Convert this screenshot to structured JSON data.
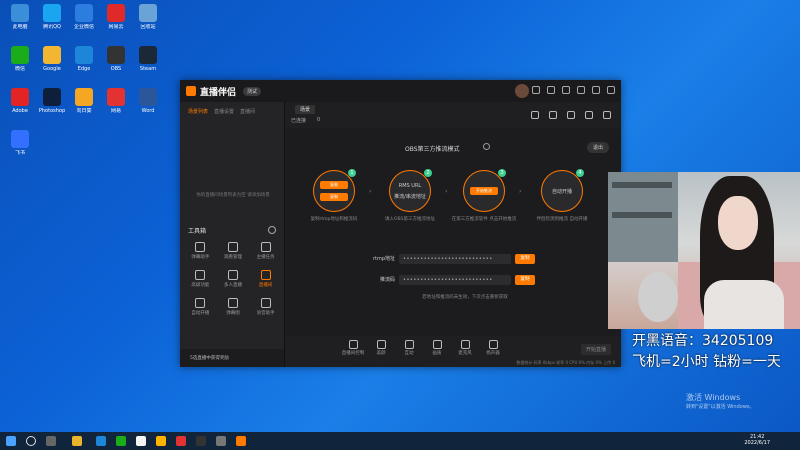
{
  "desktop": {
    "icons": [
      {
        "label": "此电脑",
        "color": "#3b8fd9"
      },
      {
        "label": "腾讯QQ",
        "color": "#1aa5f0"
      },
      {
        "label": "企业微信",
        "color": "#2c7de0"
      },
      {
        "label": "网易云",
        "color": "#e02a2a"
      },
      {
        "label": "回收站",
        "color": "#6aa4d6"
      },
      {
        "label": "微信",
        "color": "#1aad19"
      },
      {
        "label": "Google",
        "color": "#f2b632"
      },
      {
        "label": "Edge",
        "color": "#1d86d8"
      },
      {
        "label": "OBS",
        "color": "#333333"
      },
      {
        "label": "Steam",
        "color": "#1b2838"
      },
      {
        "label": "Adobe",
        "color": "#e22424"
      },
      {
        "label": "Photoshop",
        "color": "#0e1f3b"
      },
      {
        "label": "向日葵",
        "color": "#f5a623"
      },
      {
        "label": "网易",
        "color": "#e23232"
      },
      {
        "label": "Word",
        "color": "#2b579a"
      },
      {
        "label": "飞书",
        "color": "#3370ff"
      }
    ]
  },
  "app": {
    "title": "直播伴侣",
    "version": "测试",
    "left_tabs": [
      "场景列表",
      "直播设置",
      "直播间"
    ],
    "left_empty": "你的直播间场景列表为空 请添加场景",
    "toolbox_title": "工具箱",
    "tools": [
      {
        "label": "弹幕助手",
        "active": false
      },
      {
        "label": "观看管理",
        "active": false
      },
      {
        "label": "主播任务",
        "active": false
      },
      {
        "label": "高级功能",
        "active": false
      },
      {
        "label": "多人直播",
        "active": false
      },
      {
        "label": "直播间",
        "active": true
      },
      {
        "label": "自动开播",
        "active": false
      },
      {
        "label": "弹幕图",
        "active": false
      },
      {
        "label": "语音助手",
        "active": false
      }
    ],
    "left_bottom": "5选直播中获得奖励",
    "scene_tab": "场景",
    "live_status": "已连接",
    "fire_count": "0",
    "obs_title": "OBS第三方推流模式",
    "exit_label": "退出",
    "steps": [
      {
        "n": "1",
        "label": "复制",
        "sub": "复制",
        "desc": "复制rtmp地址和推流码",
        "inner": true
      },
      {
        "n": "2",
        "label": "RMS URL",
        "sub": "推流/串流地址",
        "desc": "填入OBS第三方推流地址",
        "inner": false
      },
      {
        "n": "3",
        "label": "开始推流",
        "sub": "",
        "desc": "在第三方推流软件 点击开始推流",
        "inner": true
      },
      {
        "n": "4",
        "label": "自动开播",
        "sub": "",
        "desc": "伴侣检测到推流 自动开播",
        "inner": false
      }
    ],
    "rtmp_label": "rtmp地址",
    "rtmp_value": "••••••••••••••••••••••••••",
    "key_label": "推流码",
    "key_value": "••••••••••••••••••••••••••",
    "copy_label": "复制",
    "field_note": "若地址和推流码未生效，下次点击重新获取",
    "bottom_tools": [
      "直播间控制",
      "美颜",
      "互动",
      "画质",
      "麦克风",
      "扬声器"
    ],
    "start_live": "开始直播",
    "status_text": "数据统计 码率 0kbps  帧率 0  CPU 0%  内存 0%  上传 0"
  },
  "overlay": {
    "line1": "开黑语音：34205109",
    "line2": "飞机=2小时 钻粉=一天"
  },
  "watermark": {
    "line1": "激活 Windows",
    "line2": "转到\"设置\"以激活 Windows。"
  },
  "taskbar": {
    "time": "21:42",
    "date": "2022/6/17"
  }
}
